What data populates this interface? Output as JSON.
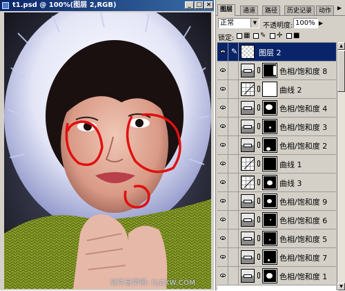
{
  "document": {
    "title": "t1.psd @ 100%(图层 2,RGB)",
    "controls": [
      "_",
      "□",
      "×"
    ],
    "watermark": "软件自学网: RJZXW.COM"
  },
  "panel": {
    "tabs": [
      "图层",
      "通道",
      "路径",
      "历史记录",
      "动作"
    ],
    "active_tab": "图层",
    "menu_arrow": "▶",
    "blend_mode": "正常",
    "opacity_label": "不透明度:",
    "opacity_value": "100%",
    "lock_label": "锁定:",
    "lock_icons": [
      "lock-transparent-icon",
      "lock-brush-icon",
      "lock-move-icon",
      "lock-all-icon"
    ]
  },
  "layers": [
    {
      "name": "图层 2",
      "type": "pixel",
      "selected": true
    },
    {
      "name": "色相/饱和度 8",
      "type": "hue-saturation"
    },
    {
      "name": "曲线 2",
      "type": "curves"
    },
    {
      "name": "色相/饱和度 4",
      "type": "hue-saturation"
    },
    {
      "name": "色相/饱和度 3",
      "type": "hue-saturation"
    },
    {
      "name": "色相/饱和度 2",
      "type": "hue-saturation"
    },
    {
      "name": "曲线 1",
      "type": "curves"
    },
    {
      "name": "曲线 3",
      "type": "curves"
    },
    {
      "name": "色相/饱和度 9",
      "type": "hue-saturation"
    },
    {
      "name": "色相/饱和度 6",
      "type": "hue-saturation"
    },
    {
      "name": "色相/饱和度 5",
      "type": "hue-saturation"
    },
    {
      "name": "色相/饱和度 7",
      "type": "hue-saturation"
    },
    {
      "name": "色相/饱和度 1",
      "type": "hue-saturation"
    }
  ],
  "colors": {
    "titlebar": "#0a246a",
    "selected_layer": "#0a246a",
    "annotation_circles": "#e01010"
  }
}
